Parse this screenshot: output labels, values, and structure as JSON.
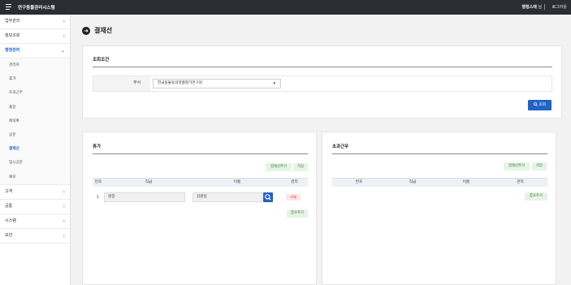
{
  "header": {
    "title": "연구동물관리시스템",
    "user_name": "행정스태",
    "user_suffix": "님",
    "logout": "로그아웃"
  },
  "sidebar": {
    "items": [
      {
        "label": "업무관리"
      },
      {
        "label": "정보조회"
      },
      {
        "label": "행정관리"
      },
      {
        "label": "고객"
      },
      {
        "label": "공통"
      },
      {
        "label": "시스템"
      },
      {
        "label": "보안"
      }
    ],
    "sub_items": [
      {
        "label": "관리자"
      },
      {
        "label": "휴가"
      },
      {
        "label": "초과근무"
      },
      {
        "label": "출장"
      },
      {
        "label": "회의록"
      },
      {
        "label": "공문"
      },
      {
        "label": "결재선"
      },
      {
        "label": "임시공문"
      },
      {
        "label": "예모"
      }
    ]
  },
  "page": {
    "title": "결재선"
  },
  "search": {
    "section_title": "조회조건",
    "dept_label": "부서",
    "dept_value": "한국동물용의약품평가연구원",
    "button": "조회"
  },
  "leave": {
    "title": "휴가",
    "btn_add_line": "결재선추가",
    "btn_save": "저장",
    "columns": [
      "번호",
      "직급",
      "이름",
      "관리"
    ],
    "rows": [
      {
        "no": "1",
        "rank": "원장",
        "name": "김원일",
        "action": "삭제"
      }
    ],
    "btn_add_ref": "참조추가"
  },
  "overtime": {
    "title": "초과근무",
    "btn_add_line": "결재선추가",
    "btn_save": "저장",
    "columns": [
      "번호",
      "직급",
      "이름",
      "관리"
    ],
    "btn_add_ref": "참조추가"
  },
  "colors": {
    "topbar": "#2b2d33",
    "accent": "#1f63c6",
    "active_menu": "#1565d8",
    "green_btn": "#e6f4e6",
    "red_btn": "#fde7e7"
  }
}
